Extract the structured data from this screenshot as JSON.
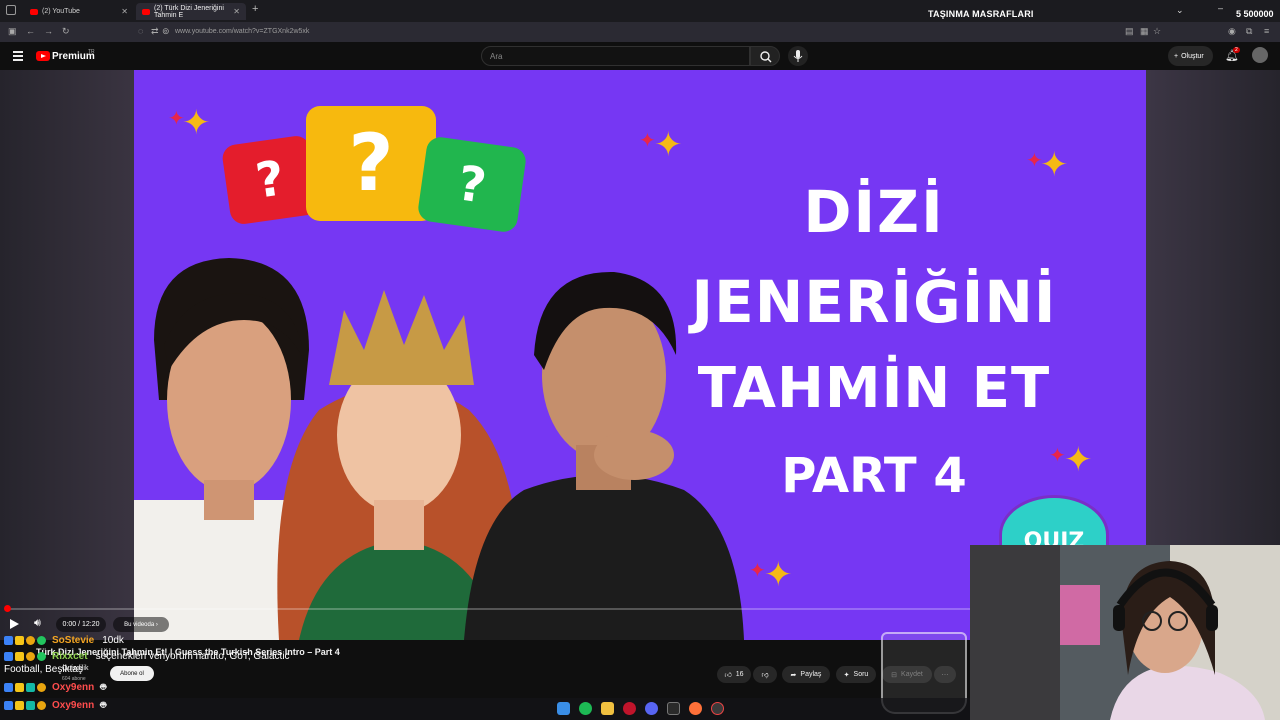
{
  "browser": {
    "tabs": [
      {
        "label": "(2) YouTube",
        "active": false
      },
      {
        "label": "(2) Türk Dizi Jeneriğini Tahmin E",
        "active": true
      }
    ],
    "url": "www.youtube.com/watch?v=ZTGXnk2w5xk"
  },
  "overlay": {
    "title": "TAŞINMA MASRAFLARI",
    "amount": "5 500000"
  },
  "youtube": {
    "brand": "Premium",
    "brand_suffix": "TR",
    "search_placeholder": "Ara",
    "create_label": "Oluştur",
    "notification_count": "2"
  },
  "video": {
    "thumbnail_title": [
      "DİZİ",
      "JENERİĞİNİ",
      "TAHMİN ET",
      "PART 4"
    ],
    "bubble_glyph": "?",
    "quiz_badge": "QUIZ",
    "time": "0:00 / 12:20",
    "chapter": "Bu videoda",
    "progress_fraction": 0.0
  },
  "meta": {
    "title": "Türk Dizi Jeneriğini Tahmin Et! | Guess the Turkish Series Intro – Part 4",
    "channel": "Quizdilik",
    "subs": "604 abone",
    "subscribe_label": "Abone ol",
    "like_count": "16",
    "share_label": "Paylaş",
    "ask_label": "Soru",
    "save_label": "Kaydet"
  },
  "chat": [
    {
      "user": "SoStevie",
      "message": "10dk",
      "color": "#f5a623"
    },
    {
      "user": "Rixxcet",
      "message": "seçenekleri veriyorum naruto, GoT, Galactic",
      "color": "#8fd14f"
    },
    {
      "user": "Oxy9enn",
      "message": "",
      "color": "#ff4d4d"
    },
    {
      "user": "Oxy9enn",
      "message": "",
      "color": "#ff4d4d"
    }
  ],
  "chat_extra": "Football, Beşiktaş",
  "colors": {
    "video_bg": "#7637f3",
    "youtube_red": "#ff0000",
    "overlay_green": "#3fd43f"
  }
}
